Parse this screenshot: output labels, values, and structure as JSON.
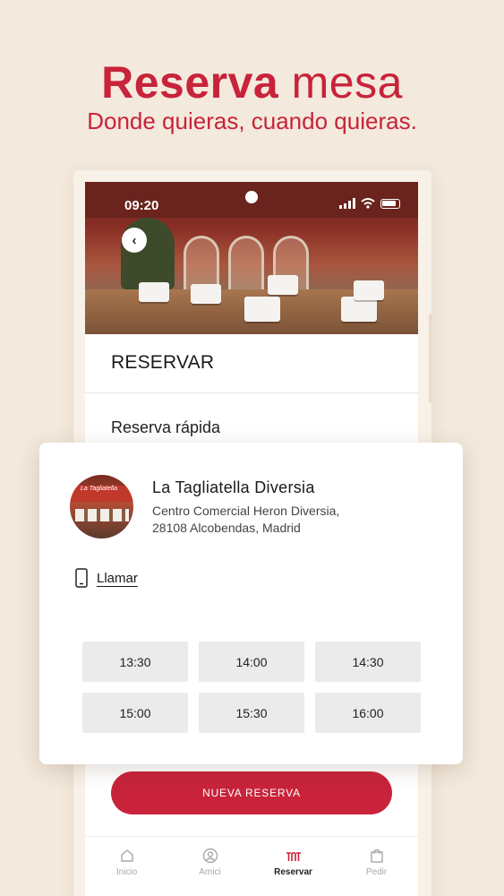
{
  "headline": {
    "title_bold": "Reserva",
    "title_light": "mesa",
    "subtitle": "Donde quieras, cuando quieras."
  },
  "status_bar": {
    "time": "09:20"
  },
  "screen": {
    "section_title": "RESERVAR",
    "quick_reserve_label": "Reserva rápida",
    "cta_label": "NUEVA RESERVA"
  },
  "restaurant": {
    "name": "La Tagliatella Diversia",
    "address_line1": "Centro Comercial Heron Diversia,",
    "address_line2": "28108 Alcobendas, Madrid",
    "avatar_sign": "La Tagliatella",
    "call_label": "Llamar"
  },
  "time_slots": [
    "13:30",
    "14:00",
    "14:30",
    "15:00",
    "15:30",
    "16:00"
  ],
  "tabbar": {
    "items": [
      {
        "label": "Inicio",
        "icon": "home-icon"
      },
      {
        "label": "Amici",
        "icon": "user-circle-icon"
      },
      {
        "label": "Reservar",
        "icon": "reservar-icon",
        "active": true
      },
      {
        "label": "Pedir",
        "icon": "bag-icon"
      }
    ]
  },
  "colors": {
    "brand_red": "#c8233a",
    "background": "#f3e9dc"
  }
}
